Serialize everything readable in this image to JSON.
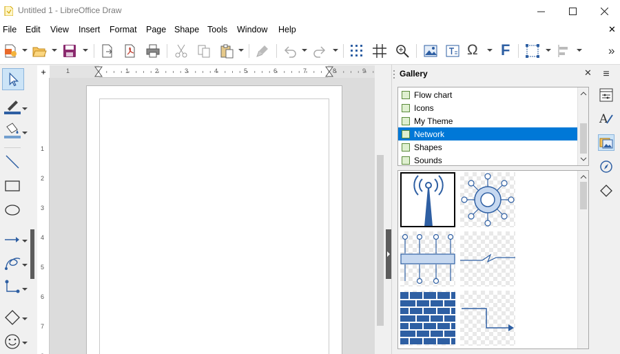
{
  "window": {
    "title": "Untitled 1 - LibreOffice Draw",
    "controls": {
      "minimize": "—",
      "maximize": "☐",
      "close": "✕"
    }
  },
  "menu": {
    "items": [
      "File",
      "Edit",
      "View",
      "Insert",
      "Format",
      "Page",
      "Shape",
      "Tools",
      "Window",
      "Help"
    ],
    "close_document": "✕"
  },
  "toolbar": {
    "overflow": "»",
    "special_char_glyph": "Ω",
    "fontwork_glyph": "F"
  },
  "ruler": {
    "h_labels": [
      "1",
      "1",
      "2",
      "3",
      "4",
      "5",
      "6",
      "7",
      "8",
      "9"
    ],
    "v_labels": [
      "1",
      "2",
      "3",
      "4",
      "5",
      "6",
      "7",
      "8"
    ]
  },
  "sidebar": {
    "title": "Gallery",
    "close_glyph": "✕",
    "menu_glyph": "≡",
    "themes": [
      {
        "label": "Flow chart",
        "selected": false
      },
      {
        "label": "Icons",
        "selected": false
      },
      {
        "label": "My Theme",
        "selected": false
      },
      {
        "label": "Network",
        "selected": true
      },
      {
        "label": "Shapes",
        "selected": false
      },
      {
        "label": "Sounds",
        "selected": false
      }
    ],
    "gallery_items": [
      "antenna",
      "hub",
      "switch",
      "wan-link",
      "firewall",
      "connector"
    ]
  },
  "colors": {
    "accent": "#0078d7",
    "icon_blue": "#2e5fa3",
    "icon_light": "#c6d8f0"
  }
}
